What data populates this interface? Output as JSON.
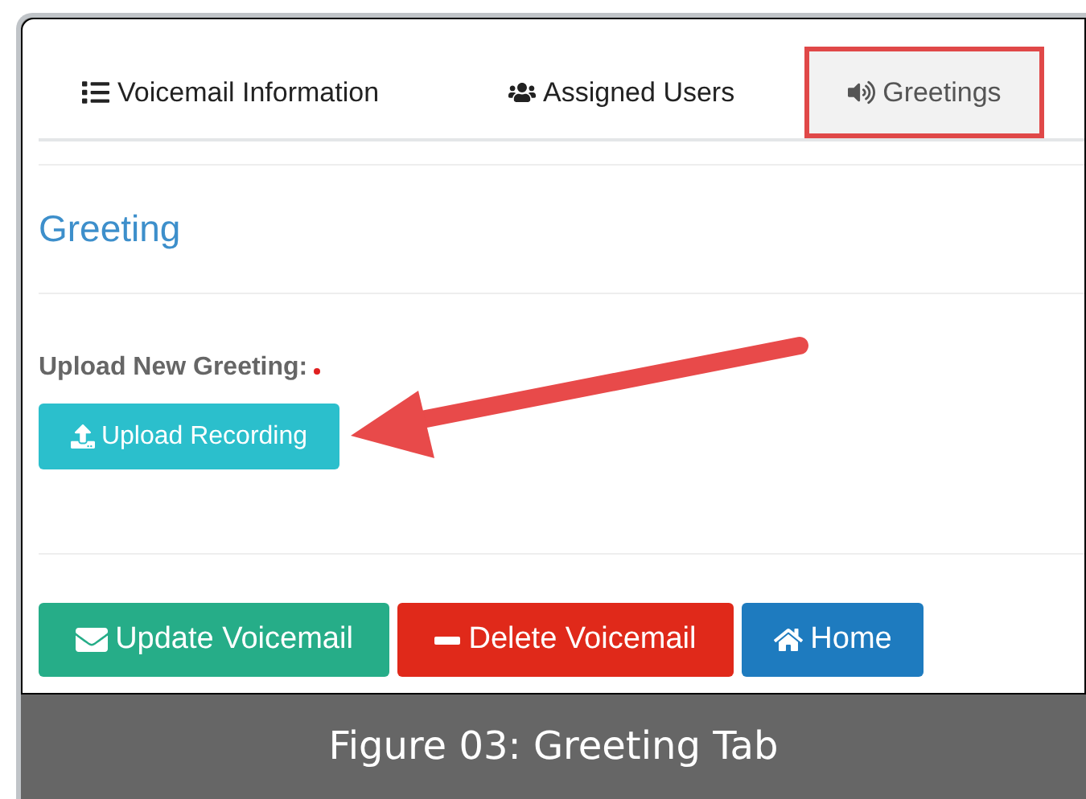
{
  "tabs": [
    {
      "label": "Voicemail Information",
      "selected": false,
      "highlighted": false
    },
    {
      "label": "Assigned Users",
      "selected": false,
      "highlighted": false
    },
    {
      "label": "Greetings",
      "selected": true,
      "highlighted": true
    }
  ],
  "section_title": "Greeting",
  "upload": {
    "label": "Upload New Greeting:",
    "required": true,
    "button": "Upload Recording"
  },
  "actions": [
    {
      "label": "Update Voicemail",
      "kind": "success"
    },
    {
      "label": "Delete Voicemail",
      "kind": "danger"
    },
    {
      "label": "Home",
      "kind": "primary"
    }
  ],
  "caption": "Figure 03: Greeting Tab"
}
